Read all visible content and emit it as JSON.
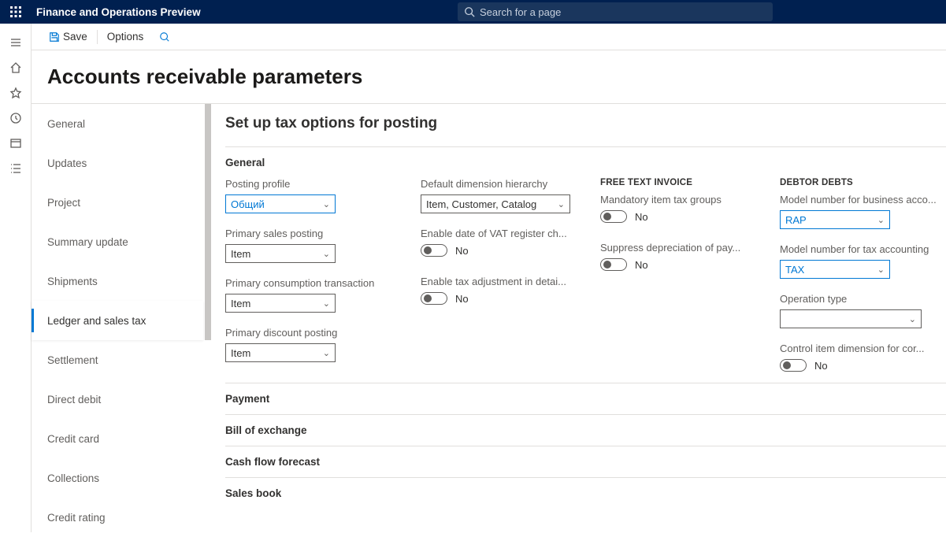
{
  "app_title": "Finance and Operations Preview",
  "search_placeholder": "Search for a page",
  "actionbar": {
    "save": "Save",
    "options": "Options"
  },
  "page_title": "Accounts receivable parameters",
  "nav_items": [
    "General",
    "Updates",
    "Project",
    "Summary update",
    "Shipments",
    "Ledger and sales tax",
    "Settlement",
    "Direct debit",
    "Credit card",
    "Collections",
    "Credit rating"
  ],
  "nav_active_index": 5,
  "content_title": "Set up tax options for posting",
  "general": {
    "section_label": "General",
    "posting_profile": {
      "label": "Posting profile",
      "value": "Общий"
    },
    "primary_sales": {
      "label": "Primary sales posting",
      "value": "Item"
    },
    "primary_consumption": {
      "label": "Primary consumption transaction",
      "value": "Item"
    },
    "primary_discount": {
      "label": "Primary discount posting",
      "value": "Item"
    },
    "default_dim": {
      "label": "Default dimension hierarchy",
      "value": "Item, Customer, Catalog"
    },
    "enable_vat_date": {
      "label": "Enable date of VAT register ch...",
      "state": "No"
    },
    "enable_tax_adj": {
      "label": "Enable tax adjustment in detai...",
      "state": "No"
    },
    "fti_head": "FREE TEXT INVOICE",
    "mandatory_item_tax": {
      "label": "Mandatory item tax groups",
      "state": "No"
    },
    "suppress_depr": {
      "label": "Suppress depreciation of pay...",
      "state": "No"
    },
    "debtor_head": "DEBTOR DEBTS",
    "model_business": {
      "label": "Model number for business acco...",
      "value": "RAP"
    },
    "model_tax": {
      "label": "Model number for tax accounting",
      "value": "TAX"
    },
    "operation_type": {
      "label": "Operation type",
      "value": ""
    },
    "control_item_dim": {
      "label": "Control item dimension for cor...",
      "state": "No"
    }
  },
  "collapsed_sections": [
    "Payment",
    "Bill of exchange",
    "Cash flow forecast",
    "Sales book"
  ]
}
